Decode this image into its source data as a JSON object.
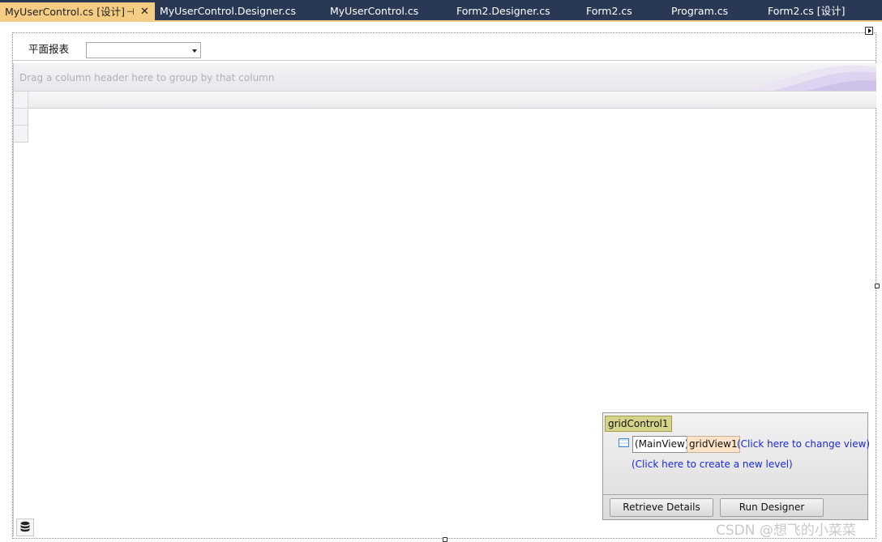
{
  "tabs": [
    {
      "label": "MyUserControl.cs [设计]",
      "active": true
    },
    {
      "label": "MyUserControl.Designer.cs"
    },
    {
      "label": "MyUserControl.cs"
    },
    {
      "label": "Form2.Designer.cs"
    },
    {
      "label": "Form2.cs"
    },
    {
      "label": "Program.cs"
    },
    {
      "label": "Form2.cs [设计]"
    }
  ],
  "tab_icons": {
    "pin": "pin-icon",
    "close": "close-icon"
  },
  "form": {
    "report_label": "平面报表",
    "combo_value": ""
  },
  "grid": {
    "group_panel_hint": "Drag a column header here to group by that column"
  },
  "level_designer": {
    "grid_control_name": "gridControl1",
    "main_view": "(MainView)",
    "view_name": "gridView1",
    "change_view_link": "(Click here to change view)",
    "new_level_link": "(Click here to create a new level)",
    "retrieve_button": "Retrieve Details",
    "run_designer_button": "Run Designer"
  },
  "watermark": "CSDN @想飞的小菜菜",
  "colors": {
    "tabstrip": "#293955",
    "active_tab": "#f5cc84",
    "link": "#1a2ad8",
    "grid_control_badge": "#d6d48a",
    "view_badge": "#fbe3c8"
  }
}
